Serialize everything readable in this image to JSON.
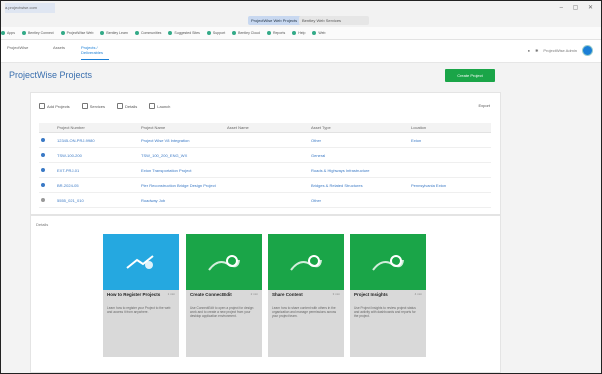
{
  "browser": {
    "address_text": "a.projectwise.com",
    "active_tab": "ProjectWise Web Projects",
    "other_tab": "Bentley Web Services",
    "window_controls": "– ▢ ✕",
    "bookmarks": [
      "Apps",
      "Bentley Connect",
      "ProjectWise Web",
      "Bentley Learn",
      "Communities",
      "Suggested Sites",
      "Support",
      "Bentley Cloud",
      "Reports",
      "Help",
      "Web"
    ]
  },
  "app": {
    "tabs": [
      "ProjectWise",
      "Assets",
      "Projects / Deliverables"
    ],
    "active_tab_index": 2,
    "user_name": "ProjectWise Admin",
    "user_initial": "A"
  },
  "page": {
    "title": "ProjectWise Projects",
    "create_button": "Create Project"
  },
  "toolbar": {
    "items": [
      "Add Projects",
      "Services",
      "Details",
      "Launch"
    ],
    "export": "Export"
  },
  "table": {
    "headers": [
      "",
      "Project Number",
      "Project Name",
      "Asset Name",
      "Asset Type",
      "Location"
    ],
    "rows": [
      [
        "",
        "12345-ON-PRJ-9980",
        "Project Wise V8 Integration",
        "",
        "Other",
        "Exton"
      ],
      [
        "",
        "TSW-100-200",
        "TSW_100_200_ENG_WX",
        "",
        "General",
        ""
      ],
      [
        "",
        "EXT-PRJ-01",
        "Exton Transportation Project",
        "",
        "Roads & Highways Infrastructure",
        ""
      ],
      [
        "",
        "BR-2024-05",
        "Pier Reconstruction Bridge Design Project",
        "",
        "Bridges & Related Structures",
        "Pennsylvania Exton"
      ],
      [
        "",
        "5555_021_010",
        "Roadway Job",
        "",
        "Other",
        ""
      ]
    ]
  },
  "details": {
    "label": "Details",
    "tiles": [
      {
        "title": "How to Register Projects",
        "step": "1 min",
        "desc": "Learn how to register your Project to the web and access it from anywhere.",
        "color": "#25a8e0"
      },
      {
        "title": "Create ConnectEdit",
        "step": "2 min",
        "desc": "Use ConnectEdit to open a project for design work and to create a new project from your desktop application environment.",
        "color": "#1aa548"
      },
      {
        "title": "Share Content",
        "step": "3 min",
        "desc": "Learn how to share content with others in the organization and manage permissions across your project team.",
        "color": "#1aa548"
      },
      {
        "title": "Project Insights",
        "step": "4 min",
        "desc": "Use Project Insights to review project status and activity with dashboards and reports for the project.",
        "color": "#1aa548"
      }
    ]
  }
}
